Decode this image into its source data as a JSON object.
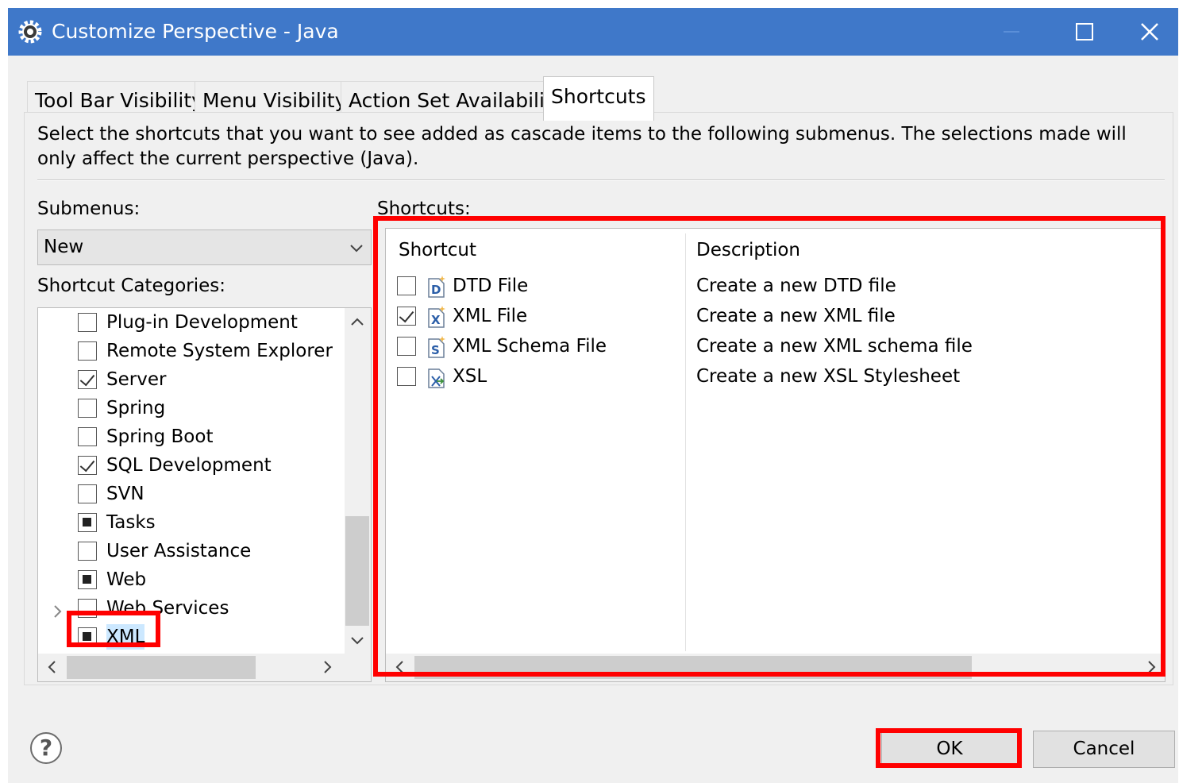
{
  "window": {
    "title": "Customize Perspective - Java",
    "icon": "eclipse-gear-icon"
  },
  "tabs": [
    {
      "label": "Tool Bar Visibility",
      "active": false
    },
    {
      "label": "Menu Visibility",
      "active": false
    },
    {
      "label": "Action Set Availability",
      "active": false
    },
    {
      "label": "Shortcuts",
      "active": true
    }
  ],
  "shortcuts_tab": {
    "description": "Select the shortcuts that you want to see added as cascade items to the following submenus.  The selections made will only affect the current perspective (Java).",
    "submenus_label": "Submenus:",
    "submenu_selected": "New",
    "categories_label": "Shortcut Categories:",
    "shortcuts_label": "Shortcuts:",
    "categories": [
      {
        "label": "Plug-in Development",
        "state": "unchecked"
      },
      {
        "label": "Remote System Explorer",
        "state": "unchecked"
      },
      {
        "label": "Server",
        "state": "checked"
      },
      {
        "label": "Spring",
        "state": "unchecked"
      },
      {
        "label": "Spring Boot",
        "state": "unchecked"
      },
      {
        "label": "SQL Development",
        "state": "checked"
      },
      {
        "label": "SVN",
        "state": "unchecked"
      },
      {
        "label": "Tasks",
        "state": "partial"
      },
      {
        "label": "User Assistance",
        "state": "unchecked"
      },
      {
        "label": "Web",
        "state": "partial"
      },
      {
        "label": "Web Services",
        "state": "unchecked",
        "expandable": true
      },
      {
        "label": "XML",
        "state": "partial",
        "selected": true
      }
    ],
    "table": {
      "columns": [
        "Shortcut",
        "Description"
      ],
      "rows": [
        {
          "name": "DTD File",
          "description": "Create a new DTD file",
          "checked": false,
          "icon": "dtd-file-icon",
          "icon_letter": "D"
        },
        {
          "name": "XML File",
          "description": "Create a new XML file",
          "checked": true,
          "icon": "xml-file-icon",
          "icon_letter": "X"
        },
        {
          "name": "XML Schema File",
          "description": "Create a new XML schema file",
          "checked": false,
          "icon": "xml-schema-file-icon",
          "icon_letter": "S"
        },
        {
          "name": "XSL",
          "description": "Create a new XSL Stylesheet",
          "checked": false,
          "icon": "xsl-file-icon",
          "icon_letter": ""
        }
      ]
    }
  },
  "buttons": {
    "ok": "OK",
    "cancel": "Cancel",
    "help": "?"
  },
  "colors": {
    "titlebar": "#3f78c9",
    "highlight": "#ff0000",
    "selection": "#cce8ff"
  }
}
